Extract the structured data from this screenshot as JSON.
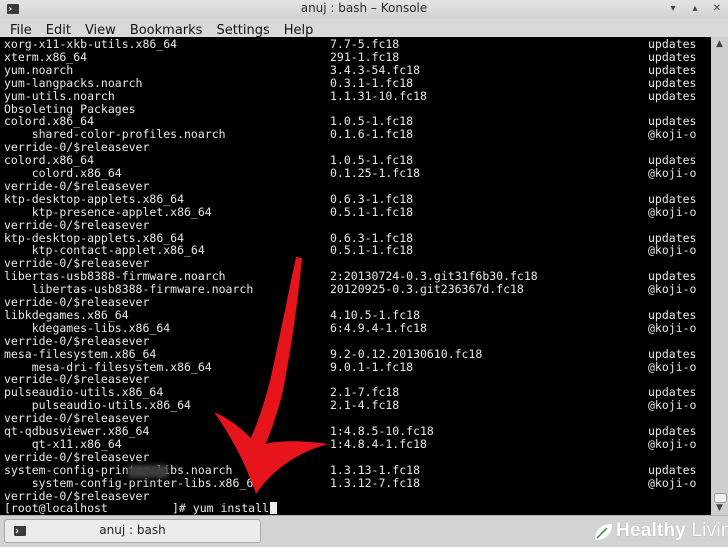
{
  "window": {
    "title": "anuj : bash – Konsole",
    "minimize_glyph": "▾",
    "maximize_glyph": "▴",
    "close_glyph": "✕"
  },
  "menu": [
    "File",
    "Edit",
    "View",
    "Bookmarks",
    "Settings",
    "Help"
  ],
  "terminal": {
    "lines": [
      [
        "xorg-x11-xkb-utils.x86_64",
        "7.7-5.fc18",
        "updates"
      ],
      [
        "xterm.x86_64",
        "291-1.fc18",
        "updates"
      ],
      [
        "yum.noarch",
        "3.4.3-54.fc18",
        "updates"
      ],
      [
        "yum-langpacks.noarch",
        "0.3.1-1.fc18",
        "updates"
      ],
      [
        "yum-utils.noarch",
        "1.1.31-10.fc18",
        "updates"
      ],
      [
        "Obsoleting Packages",
        "",
        ""
      ],
      [
        "colord.x86_64",
        "1.0.5-1.fc18",
        "updates"
      ],
      [
        "    shared-color-profiles.noarch",
        "0.1.6-1.fc18",
        "@koji-o"
      ],
      [
        "verride-0/$releasever",
        "",
        ""
      ],
      [
        "colord.x86_64",
        "1.0.5-1.fc18",
        "updates"
      ],
      [
        "    colord.x86_64",
        "0.1.25-1.fc18",
        "@koji-o"
      ],
      [
        "verride-0/$releasever",
        "",
        ""
      ],
      [
        "ktp-desktop-applets.x86_64",
        "0.6.3-1.fc18",
        "updates"
      ],
      [
        "    ktp-presence-applet.x86_64",
        "0.5.1-1.fc18",
        "@koji-o"
      ],
      [
        "verride-0/$releasever",
        "",
        ""
      ],
      [
        "ktp-desktop-applets.x86_64",
        "0.6.3-1.fc18",
        "updates"
      ],
      [
        "    ktp-contact-applet.x86_64",
        "0.5.1-1.fc18",
        "@koji-o"
      ],
      [
        "verride-0/$releasever",
        "",
        ""
      ],
      [
        "libertas-usb8388-firmware.noarch",
        "2:20130724-0.3.git31f6b30.fc18",
        "updates"
      ],
      [
        "    libertas-usb8388-firmware.noarch",
        "20120925-0.3.git236367d.fc18",
        "@koji-o"
      ],
      [
        "verride-0/$releasever",
        "",
        ""
      ],
      [
        "libkdegames.x86_64",
        "4.10.5-1.fc18",
        "updates"
      ],
      [
        "    kdegames-libs.x86_64",
        "6:4.9.4-1.fc18",
        "@koji-o"
      ],
      [
        "verride-0/$releasever",
        "",
        ""
      ],
      [
        "mesa-filesystem.x86_64",
        "9.2-0.12.20130610.fc18",
        "updates"
      ],
      [
        "    mesa-dri-filesystem.x86_64",
        "9.0.1-1.fc18",
        "@koji-o"
      ],
      [
        "verride-0/$releasever",
        "",
        ""
      ],
      [
        "pulseaudio-utils.x86_64",
        "2.1-7.fc18",
        "updates"
      ],
      [
        "    pulseaudio-utils.x86_64",
        "2.1-4.fc18",
        "@koji-o"
      ],
      [
        "verride-0/$releasever",
        "",
        ""
      ],
      [
        "qt-qdbusviewer.x86_64",
        "1:4.8.5-10.fc18",
        "updates"
      ],
      [
        "    qt-x11.x86_64",
        "1:4.8.4-1.fc18",
        "@koji-o"
      ],
      [
        "verride-0/$releasever",
        "",
        ""
      ],
      [
        "system-config-printer-libs.noarch",
        "1.3.13-1.fc18",
        "updates"
      ],
      [
        "    system-config-printer-libs.x86_64",
        "1.3.12-7.fc18",
        "@koji-o"
      ],
      [
        "verride-0/$releasever",
        "",
        ""
      ]
    ],
    "prompt_prefix": "[root@localhost",
    "prompt_suffix": "]# yum install"
  },
  "tabs": [
    {
      "label": "anuj : bash"
    }
  ],
  "watermark": {
    "brand_bold": "Healthy",
    "brand_light": "Living"
  },
  "colors": {
    "arrow": "#e8141b",
    "terminal_bg": "#000000",
    "terminal_fg": "#e8e8e8"
  }
}
